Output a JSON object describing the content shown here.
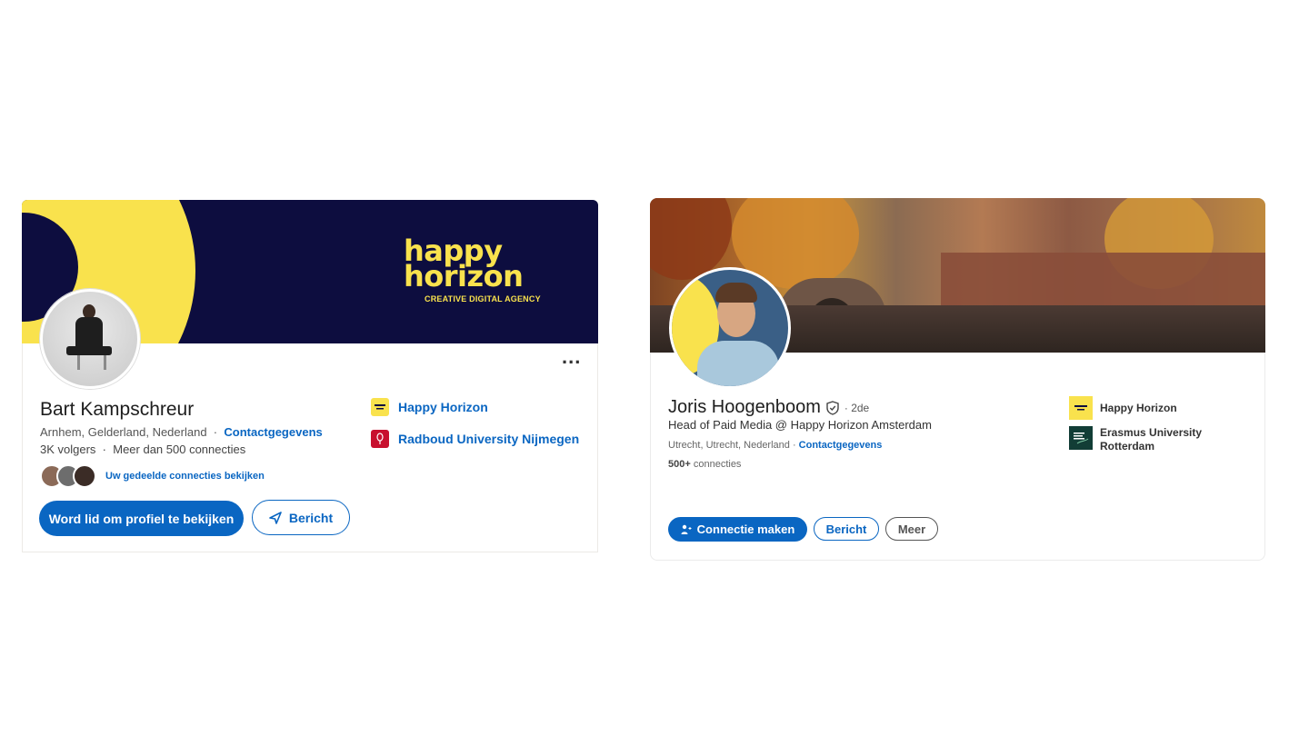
{
  "left_profile": {
    "banner_logo_line1": "happy",
    "banner_logo_line2": "horizon",
    "banner_tagline": "CREATIVE DIGITAL AGENCY",
    "more_label": "...",
    "name": "Bart Kampschreur",
    "location": "Arnhem, Gelderland, Nederland",
    "separator": "·",
    "contact_link": "Contactgegevens",
    "followers": "3K volgers",
    "connections": "Meer dan 500 connecties",
    "shared_connections": "Uw gedeelde connecties bekijken",
    "join_button": "Word lid om profiel te bekijken",
    "message_button": "Bericht",
    "organizations": [
      {
        "name": "Happy Horizon",
        "logo_color": "#f9e24d"
      },
      {
        "name": "Radboud University Nijmegen",
        "logo_color": "#c8102e"
      }
    ]
  },
  "right_profile": {
    "name": "Joris Hoogenboom",
    "degree": "· 2de",
    "headline": "Head of Paid Media @ Happy Horizon Amsterdam",
    "location": "Utrecht, Utrecht, Nederland",
    "contact_link": "Contactgegevens",
    "connections_count": "500+",
    "connections_label": "connecties",
    "connect_button": "Connectie maken",
    "message_button": "Bericht",
    "more_button": "Meer",
    "organizations": [
      {
        "name": "Happy Horizon",
        "logo_color": "#f9e24d"
      },
      {
        "name_line1": "Erasmus University",
        "name_line2": "Rotterdam",
        "logo_color": "#123d36"
      }
    ]
  },
  "colors": {
    "linkedin_blue": "#0a66c2",
    "brand_yellow": "#f9e24d",
    "brand_navy": "#0d0d3f"
  }
}
